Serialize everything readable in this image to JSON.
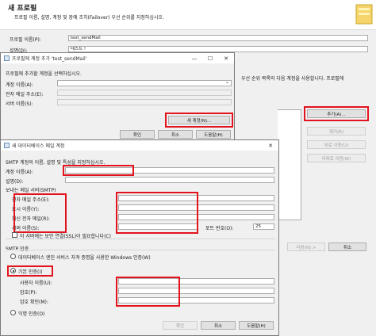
{
  "profile_window": {
    "title": "새 프로필",
    "description": "프로필 이름, 설명, 계정 및 장애 조치(Failover) 우선 순위를 지정하십시오.",
    "profile_name_label": "프로필 이름(P):",
    "profile_name_value": "test_sendMail",
    "desc_label": "설명(D):",
    "desc_value": "테스트 !",
    "list_hint": "우선 순위 목록의 다음 계정을 사용합니다. 프로필에",
    "add_button": "추가(A)...",
    "remove_button": "제거(R)",
    "move_up_button": "위로 이동(U)",
    "move_down_button": "아래로 이동(W)",
    "next_button": "다음(N) >",
    "cancel_button": "취소"
  },
  "add_account_dialog": {
    "title": "프로필에 계정 추가 'test_sendMail'",
    "instruction": "프로필에 추가할 계정을 선택하십시오.",
    "account_name_label": "계정 이름(A):",
    "email_label": "전자 메일 주소(E):",
    "server_label": "서버 이름(S):",
    "new_account_button": "새 계정(N)...",
    "ok_button": "확인",
    "cancel_button": "취소",
    "help_button": "도움말(H)"
  },
  "new_account_dialog": {
    "title": "새 데이터베이스 메일 계정",
    "instruction": "SMTP 계정의 이름, 설명 및 특성을 지정하십시오.",
    "account_name_label": "계정 이름(A):",
    "desc_label": "설명(D):",
    "outgoing_group": "보내는 메일 서버(SMTP)",
    "email_label": "전자 메일 주소(E):",
    "display_name_label": "표시 이름(Y):",
    "reply_email_label": "회신 전자 메일(R):",
    "server_label": "서버 이름(S):",
    "port_label": "포트 번호(O):",
    "port_value": "25",
    "ssl_label": "이 서버에는 보안 연결(SSL)이 필요합니다(C)",
    "auth_group": "SMTP 인증",
    "windows_auth_label": "데이터베이스 엔진 서비스 자격 증명을 사용한 Windows 인증(W)",
    "basic_auth_label": "기본 인증(I)",
    "user_label": "사용자 이름(U):",
    "password_label": "암호(P):",
    "confirm_label": "암호 확인(M):",
    "anonymous_label": "익명 인증(O)",
    "ok_button": "확인",
    "cancel_button": "취소",
    "help_button": "도움말(H)"
  },
  "colors": {
    "highlight": "#e3131e",
    "window_bg": "#f0f0f0"
  }
}
